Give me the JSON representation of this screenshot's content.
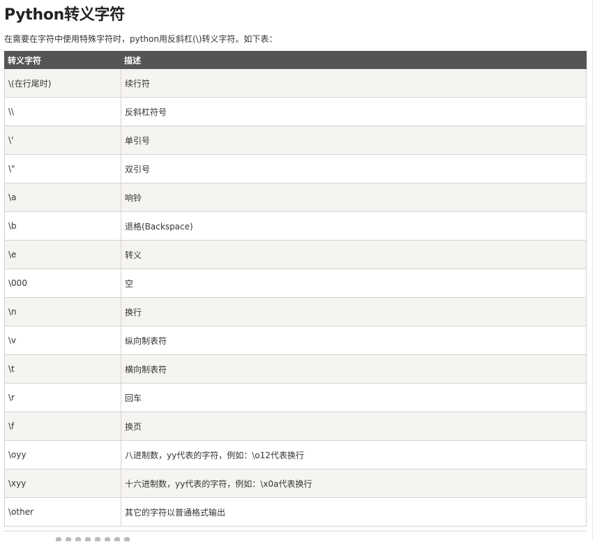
{
  "page": {
    "title": "Python转义字符",
    "intro": "在需要在字符中使用特殊字符时，python用反斜杠(\\)转义字符。如下表："
  },
  "table": {
    "headers": [
      "转义字符",
      "描述"
    ],
    "rows": [
      {
        "code": "\\(在行尾时)",
        "desc": "续行符"
      },
      {
        "code": "\\\\",
        "desc": "反斜杠符号"
      },
      {
        "code": "\\'",
        "desc": "单引号"
      },
      {
        "code": "\\\"",
        "desc": "双引号"
      },
      {
        "code": "\\a",
        "desc": "响铃"
      },
      {
        "code": "\\b",
        "desc": "退格(Backspace)"
      },
      {
        "code": "\\e",
        "desc": "转义"
      },
      {
        "code": "\\000",
        "desc": "空"
      },
      {
        "code": "\\n",
        "desc": "换行"
      },
      {
        "code": "\\v",
        "desc": "纵向制表符"
      },
      {
        "code": "\\t",
        "desc": "横向制表符"
      },
      {
        "code": "\\r",
        "desc": "回车"
      },
      {
        "code": "\\f",
        "desc": "换页"
      },
      {
        "code": "\\oyy",
        "desc": "八进制数，yy代表的字符，例如：\\o12代表换行"
      },
      {
        "code": "\\xyy",
        "desc": "十六进制数，yy代表的字符，例如：\\x0a代表换行"
      },
      {
        "code": "\\other",
        "desc": "其它的字符以普通格式输出"
      }
    ]
  },
  "colors": {
    "header_bg": "#555555",
    "odd_row_bg": "#f6f4f0",
    "border": "#d4d4d4"
  }
}
